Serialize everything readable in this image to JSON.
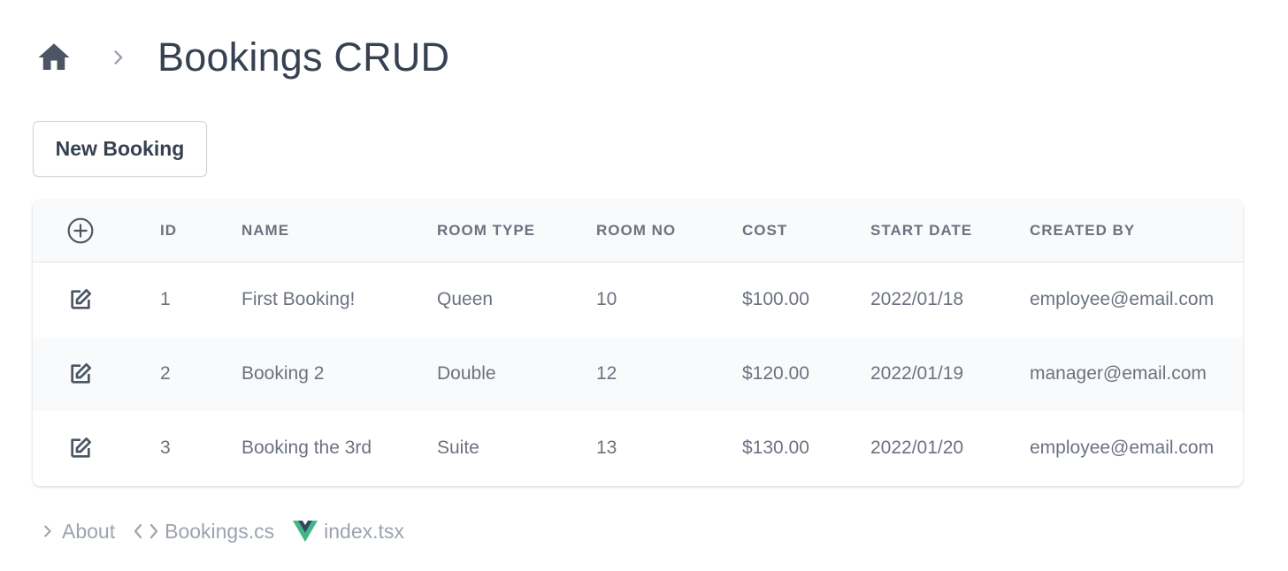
{
  "breadcrumb": {
    "home_icon": "home-icon",
    "separator_icon": "chevron-right-icon",
    "title": "Bookings CRUD"
  },
  "toolbar": {
    "new_label": "New Booking"
  },
  "table": {
    "add_icon": "plus-circle-icon",
    "edit_icon": "edit-icon",
    "columns": {
      "id": "ID",
      "name": "NAME",
      "room_type": "ROOM TYPE",
      "room_no": "ROOM NO",
      "cost": "COST",
      "start_date": "START DATE",
      "created_by": "CREATED BY"
    },
    "rows": [
      {
        "id": "1",
        "name": "First Booking!",
        "room_type": "Queen",
        "room_no": "10",
        "cost": "$100.00",
        "start_date": "2022/01/18",
        "created_by": "employee@email.com"
      },
      {
        "id": "2",
        "name": "Booking 2",
        "room_type": "Double",
        "room_no": "12",
        "cost": "$120.00",
        "start_date": "2022/01/19",
        "created_by": "manager@email.com"
      },
      {
        "id": "3",
        "name": "Booking the 3rd",
        "room_type": "Suite",
        "room_no": "13",
        "cost": "$130.00",
        "start_date": "2022/01/20",
        "created_by": "employee@email.com"
      }
    ]
  },
  "footer": {
    "links": [
      {
        "label": "About",
        "icon": "chevron-right-icon"
      },
      {
        "label": "Bookings.cs",
        "icon": "code-icon"
      },
      {
        "label": "index.tsx",
        "icon": "vue-logo-icon"
      }
    ]
  },
  "colors": {
    "title": "#374151",
    "text": "#6b7280",
    "muted": "#9ca3af",
    "header_bg": "#f9fafb",
    "vue_green": "#41b883",
    "vue_dark": "#34495e"
  }
}
